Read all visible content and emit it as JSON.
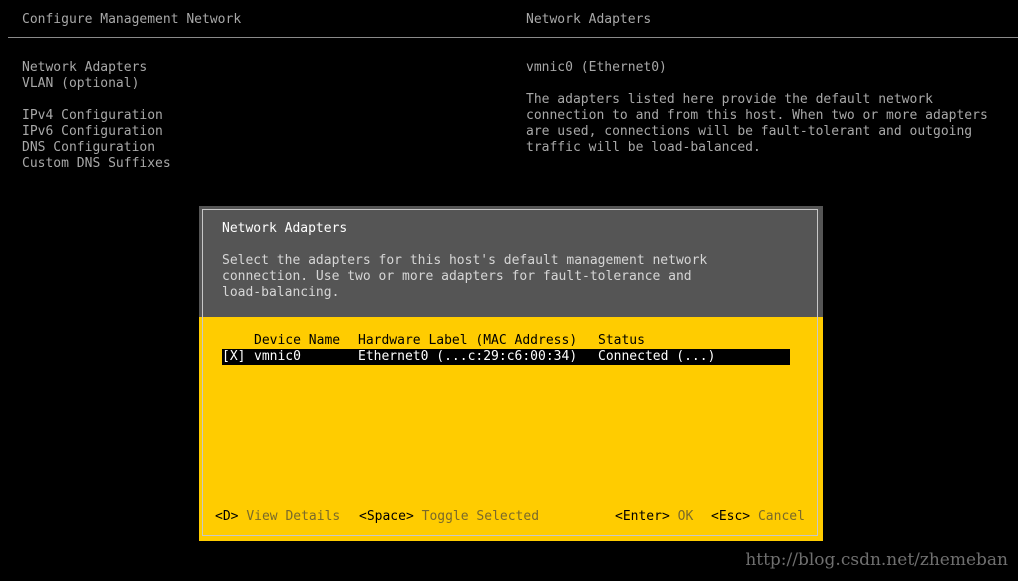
{
  "header": {
    "left_title": "Configure Management Network",
    "right_title": "Network Adapters"
  },
  "menu": {
    "items": [
      "Network Adapters",
      "VLAN (optional)",
      "IPv4 Configuration",
      "IPv6 Configuration",
      "DNS Configuration",
      "Custom DNS Suffixes"
    ]
  },
  "info": {
    "adapter": "vmnic0 (Ethernet0)",
    "description": [
      "The adapters listed here provide the default network",
      "connection to and from this host. When two or more adapters",
      "are used, connections will be fault-tolerant and outgoing",
      "traffic will be load-balanced."
    ]
  },
  "dialog": {
    "title": "Network Adapters",
    "description": [
      "Select the adapters for this host's default management network",
      "connection. Use two or more adapters for fault-tolerance and",
      "load-balancing."
    ],
    "columns": {
      "device": "Device Name",
      "hardware": "Hardware Label (MAC Address)",
      "status": "Status"
    },
    "rows": [
      {
        "check": "[X]",
        "device": "vmnic0",
        "hardware": "Ethernet0 (...c:29:c6:00:34)",
        "status": "Connected (...)"
      }
    ],
    "footer": {
      "details_key": "<D>",
      "details_label": "View Details",
      "toggle_key": "<Space>",
      "toggle_label": "Toggle Selected",
      "ok_key": "<Enter>",
      "ok_label": "OK",
      "cancel_key": "<Esc>",
      "cancel_label": "Cancel"
    }
  },
  "watermark": "http://blog.csdn.net/zhemeban",
  "colors": {
    "background": "#000000",
    "dialog_body": "#ffcc00",
    "dialog_header": "#555555",
    "selected_row": "#000000"
  }
}
